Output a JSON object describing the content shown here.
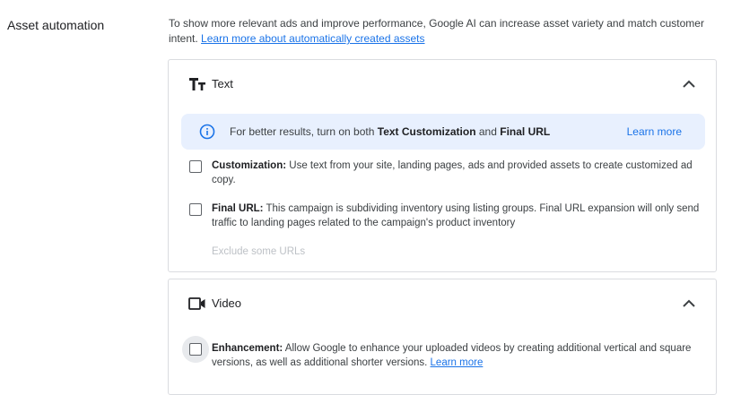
{
  "section": {
    "label": "Asset automation"
  },
  "intro": {
    "text": "To show more relevant ads and improve performance, Google AI can increase asset variety and match customer intent.",
    "link": "Learn more about automatically created assets"
  },
  "text_card": {
    "title": "Text",
    "icon": "text-format-icon",
    "banner": {
      "prefix": "For better results, turn on both ",
      "bold1": "Text Customization",
      "middle": " and ",
      "bold2": "Final URL",
      "learn_more": "Learn more"
    },
    "options": [
      {
        "bold": "Customization:",
        "text": " Use text from your site, landing pages, ads and provided assets to create customized ad copy.",
        "checked": false
      },
      {
        "bold": "Final URL:",
        "text": " This campaign is subdividing inventory using listing groups. Final URL expansion will only send traffic to landing pages related to the campaign's product inventory",
        "checked": false
      }
    ],
    "exclude_link": "Exclude some URLs"
  },
  "video_card": {
    "title": "Video",
    "icon": "video-camera-icon",
    "option": {
      "bold": "Enhancement:",
      "text": " Allow Google to enhance your uploaded videos by creating additional vertical and square versions, as well as additional shorter versions. ",
      "link": "Learn more",
      "checked": false
    }
  },
  "colors": {
    "accent": "#1a73e8",
    "banner_bg": "#e8f0fe",
    "border": "#dadce0"
  }
}
